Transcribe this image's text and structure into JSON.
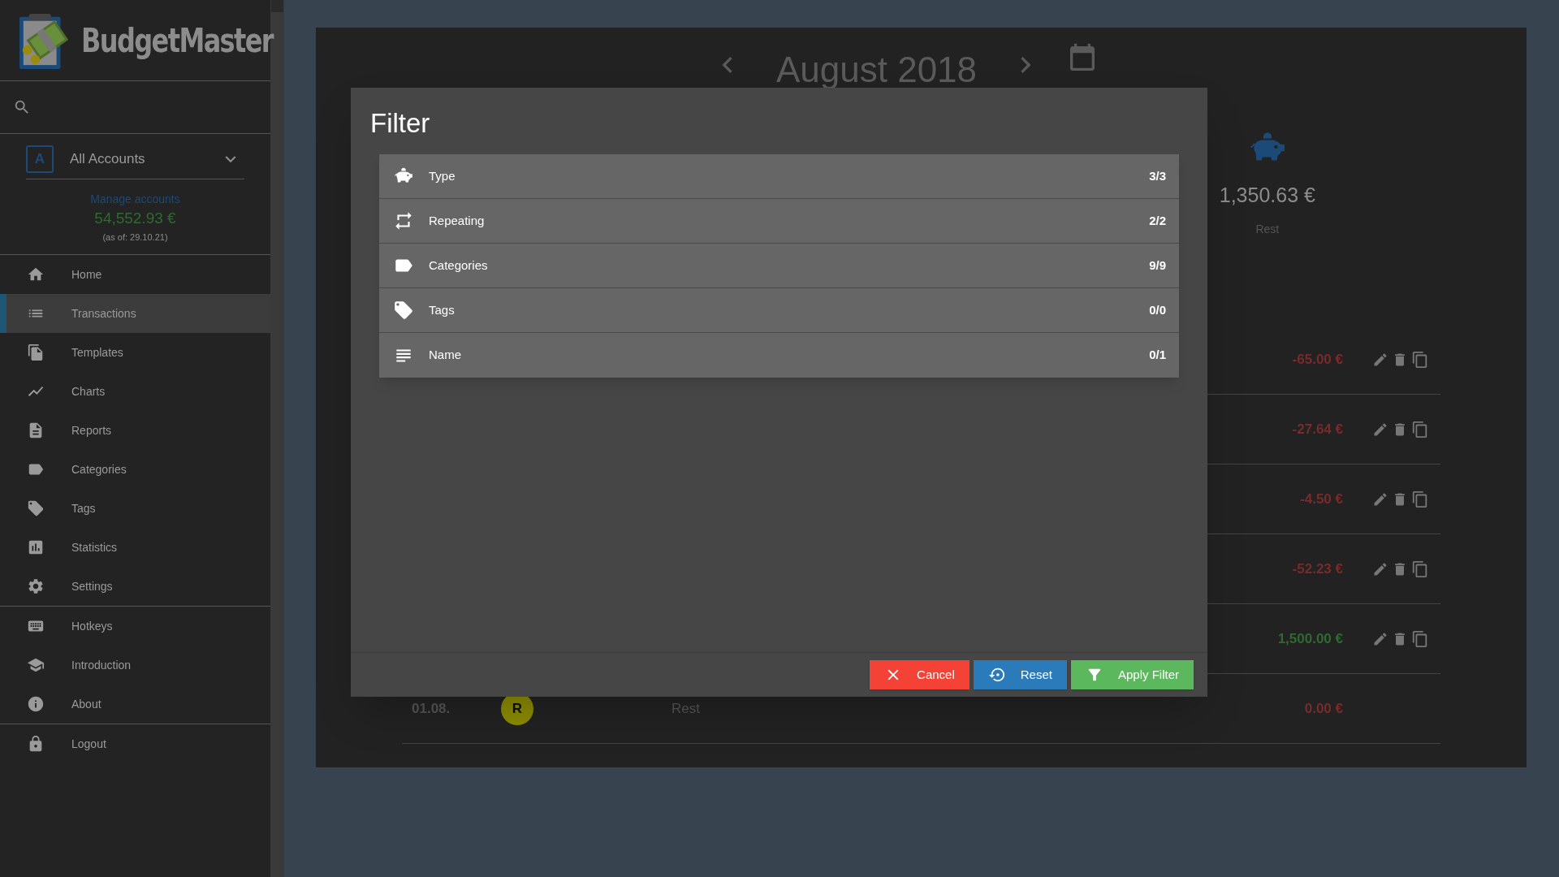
{
  "sidebar": {
    "logo_text": "BudgetMaster",
    "account": {
      "badge": "A",
      "name": "All Accounts"
    },
    "manage_link": "Manage accounts",
    "balance": "54,552.93 €",
    "as_of": "(as of: 29.10.21)",
    "menu_groups": [
      [
        {
          "label": "Home",
          "selected": false
        },
        {
          "label": "Transactions",
          "selected": true
        },
        {
          "label": "Templates",
          "selected": false
        },
        {
          "label": "Charts",
          "selected": false
        },
        {
          "label": "Reports",
          "selected": false
        },
        {
          "label": "Categories",
          "selected": false
        },
        {
          "label": "Tags",
          "selected": false
        },
        {
          "label": "Statistics",
          "selected": false
        },
        {
          "label": "Settings",
          "selected": false
        }
      ],
      [
        {
          "label": "Hotkeys",
          "selected": false
        },
        {
          "label": "Introduction",
          "selected": false
        },
        {
          "label": "About",
          "selected": false
        }
      ],
      [
        {
          "label": "Logout",
          "selected": false
        }
      ]
    ]
  },
  "main": {
    "month": "August 2018",
    "summary": {
      "amount": "1,350.63 €",
      "label": "Rest"
    },
    "transactions": [
      {
        "amount": "-65.00 €",
        "kind": "expense",
        "actions": true
      },
      {
        "amount": "-27.64 €",
        "kind": "expense",
        "actions": true
      },
      {
        "amount": "-4.50 €",
        "kind": "expense",
        "actions": true
      },
      {
        "amount": "-52.23 €",
        "kind": "expense",
        "actions": true
      },
      {
        "amount": "1,500.00 €",
        "kind": "income",
        "actions": true
      },
      {
        "date": "01.08.",
        "badge": "R",
        "color": "#8c8c00",
        "name": "Rest",
        "amount": "0.00 €",
        "kind": "expense",
        "actions": false
      }
    ]
  },
  "filter_dialog": {
    "title": "Filter",
    "filters": [
      {
        "label": "Type",
        "count": "3/3"
      },
      {
        "label": "Repeating",
        "count": "2/2"
      },
      {
        "label": "Categories",
        "count": "9/9"
      },
      {
        "label": "Tags",
        "count": "0/0"
      },
      {
        "label": "Name",
        "count": "0/1"
      }
    ],
    "buttons": [
      {
        "label": "Cancel",
        "kind": "cancel"
      },
      {
        "label": "Reset",
        "kind": "reset"
      },
      {
        "label": "Apply Filter",
        "kind": "apply"
      }
    ]
  }
}
